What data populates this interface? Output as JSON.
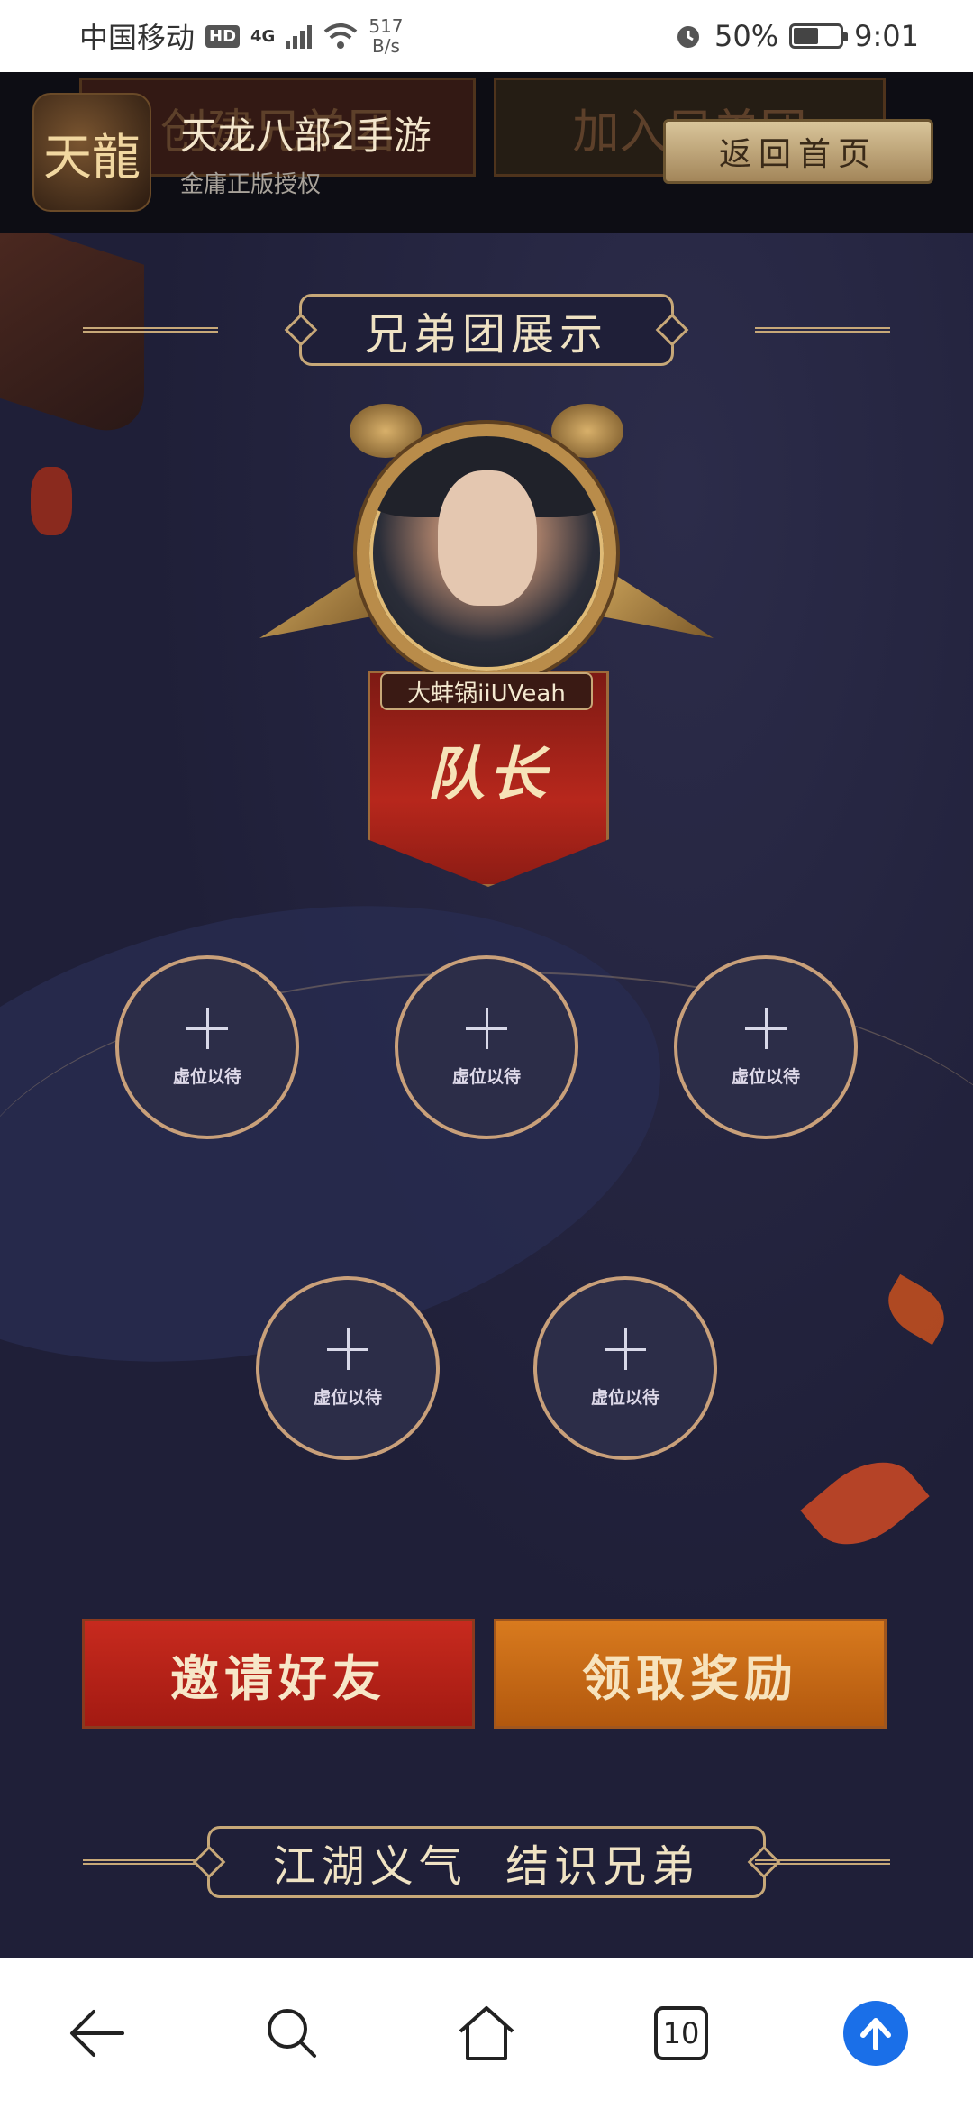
{
  "status_bar": {
    "carrier": "中国移动",
    "hd": "HD",
    "signal": "4G",
    "speed_value": "517",
    "speed_unit": "B/s",
    "battery_percent": "50%",
    "battery_level": 0.5,
    "time": "9:01"
  },
  "game_banner": {
    "logo_text": "天龍",
    "name": "天龙八部2手游",
    "subtitle": "金庸正版授权",
    "home_button": "返回首页",
    "ghost_left": "创建兄弟团",
    "ghost_right": "加入兄弟团"
  },
  "section_title": "兄弟团展示",
  "captain": {
    "name": "大蚌锅iiUVeah",
    "role": "队长"
  },
  "slots": {
    "empty_label": "虚位以待"
  },
  "actions": {
    "invite": "邀请好友",
    "reward": "领取奖励"
  },
  "footer_title": "江湖义气  结识兄弟",
  "nav_bar": {
    "tabs_count": "10"
  },
  "colors": {
    "background": "#1f1f38",
    "gold": "#c7a878",
    "invite_red": "#c72a1e",
    "reward_orange": "#d87a1e",
    "nav_blue": "#1a6fe8"
  }
}
